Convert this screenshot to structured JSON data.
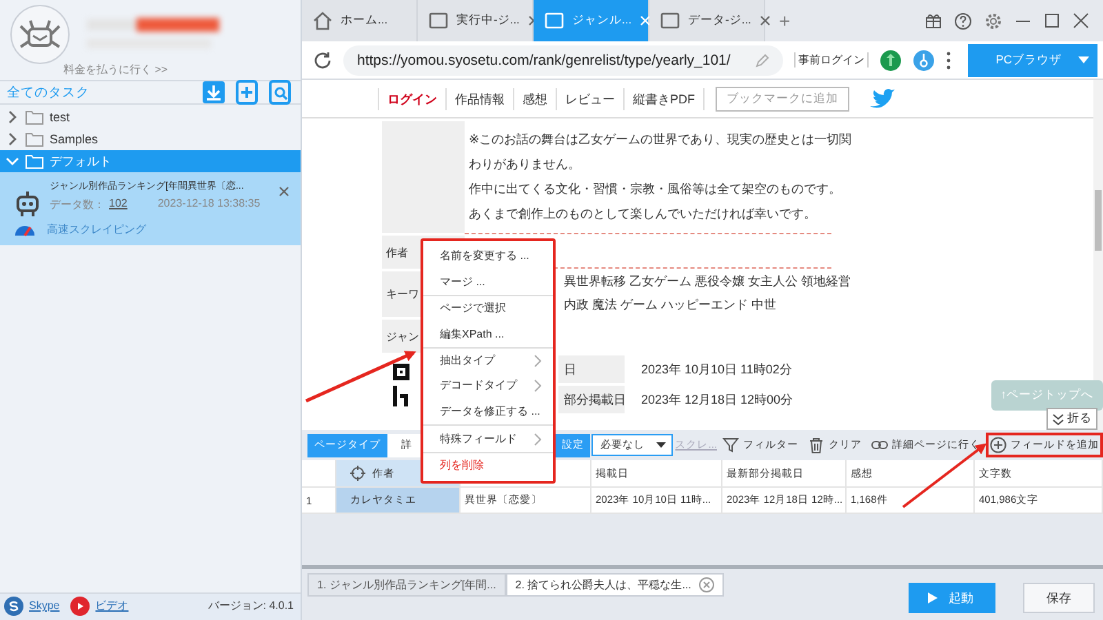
{
  "sidebar": {
    "pay_link": "料金を払うに行く >>",
    "tasks_title": "全てのタスク",
    "tree": [
      {
        "label": "test",
        "expanded": false,
        "selected": false
      },
      {
        "label": "Samples",
        "expanded": false,
        "selected": false
      },
      {
        "label": "デフォルト",
        "expanded": true,
        "selected": true,
        "children": [
          {
            "kind": "task",
            "title": "ジャンル別作品ランキング[年間異世界〔恋...",
            "data_count_label": "データ数：",
            "data_count": "102",
            "timestamp": "2023-12-18 13:38:35",
            "mode": "高速スクレイピング"
          }
        ]
      }
    ],
    "footer_links": [
      {
        "kind": "skype",
        "label": "Skype"
      },
      {
        "kind": "video",
        "label": "ビデオ"
      }
    ],
    "version": "バージョン: 4.0.1"
  },
  "browser": {
    "tabs": [
      {
        "kind": "home",
        "label": "ホーム...",
        "selected": false,
        "closable": false
      },
      {
        "kind": "page",
        "label": "実行中-ジ...",
        "selected": false,
        "closable": true
      },
      {
        "kind": "page",
        "label": "ジャンル...",
        "selected": true,
        "closable": true
      },
      {
        "kind": "page",
        "label": "データ-ジ...",
        "selected": false,
        "closable": true
      }
    ],
    "new_tab": "+",
    "url": "https://yomou.syosetu.com/rank/genrelist/type/yearly_101/",
    "login_label": "事前ログイン",
    "mode_button": "PCブラウザ"
  },
  "page": {
    "nav": [
      {
        "label": "ログイン",
        "active": true
      },
      {
        "label": "作品情報",
        "active": false
      },
      {
        "label": "感想",
        "active": false
      },
      {
        "label": "レビュー",
        "active": false
      },
      {
        "label": "縦書きPDF",
        "active": false
      }
    ],
    "bookmark_button": "ブックマークに追加",
    "notice_lines": [
      "※このお話の舞台は乙女ゲームの世界であり、現実の歴史とは一切関",
      "わりがありません。",
      "作中に出てくる文化・習慣・宗教・風俗等は全て架空のものです。",
      "あくまで創作上のものとして楽しんでいただければ幸いです。"
    ],
    "fields": [
      {
        "label": "作者",
        "highlighted": true
      },
      {
        "label": "キーワ",
        "highlighted": false,
        "values": [
          "異世界転移 乙女ゲーム 悪役令嬢 女主人公 領地経営",
          "内政 魔法 ゲーム ハッピーエンド 中世"
        ]
      },
      {
        "label": "ジャン",
        "highlighted": false
      }
    ],
    "info_rows": [
      {
        "label": "日",
        "value": "2023年 10月10日 11時02分"
      },
      {
        "label": "部分掲載日",
        "value": "2023年 12月18日 12時00分"
      }
    ],
    "page_top_button": "↑ページトップへ",
    "collapse_button": "折る"
  },
  "context_menu": [
    {
      "label": "名前を変更する ...",
      "submenu": false,
      "danger": false,
      "divider_after": false
    },
    {
      "label": "マージ ...",
      "submenu": false,
      "danger": false,
      "divider_after": true
    },
    {
      "label": "ページで選択",
      "submenu": false,
      "danger": false,
      "divider_after": false
    },
    {
      "label": "編集XPath ...",
      "submenu": false,
      "danger": false,
      "divider_after": true
    },
    {
      "label": "抽出タイプ",
      "submenu": true,
      "danger": false,
      "divider_after": false
    },
    {
      "label": "デコードタイプ",
      "submenu": true,
      "danger": false,
      "divider_after": false
    },
    {
      "label": "データを修正する ...",
      "submenu": false,
      "danger": false,
      "divider_after": true
    },
    {
      "label": "特殊フィールド",
      "submenu": true,
      "danger": false,
      "divider_after": true
    },
    {
      "label": "列を削除",
      "submenu": false,
      "danger": true,
      "divider_after": false
    }
  ],
  "panel": {
    "page_type_label": "ページタイプ",
    "page_type_value": "詳",
    "settings_label": "設定",
    "select_value": "必要なし",
    "scrape_link": "スクレ...",
    "actions": [
      {
        "kind": "filter",
        "label": "フィルター",
        "highlighted": false
      },
      {
        "kind": "clear",
        "label": "クリア",
        "highlighted": false
      },
      {
        "kind": "link",
        "label": "詳細ページに行く",
        "highlighted": false
      },
      {
        "kind": "add",
        "label": "フィールドを追加",
        "highlighted": true
      }
    ]
  },
  "table": {
    "columns": [
      {
        "selected": false
      },
      {
        "label": "作者",
        "selected": true
      },
      {
        "selected": false
      },
      {
        "label": "掲載日",
        "selected": false
      },
      {
        "label": "最新部分掲載日",
        "selected": false
      },
      {
        "label": "感想",
        "selected": false
      },
      {
        "label": "文字数",
        "selected": false
      }
    ],
    "rows": [
      [
        "1",
        "カレヤタミエ",
        "異世界〔恋愛〕",
        "2023年 10月10日 11時...",
        "2023年 12月18日 12時...",
        "1,168件",
        "401,986文字"
      ]
    ]
  },
  "task_tabs": [
    {
      "label": "1. ジャンル別作品ランキング[年間...",
      "selected": false
    },
    {
      "label": "2. 捨てられ公爵夫人は、平穏な生...",
      "selected": true
    }
  ],
  "start_button": "起動",
  "save_button": "保存"
}
